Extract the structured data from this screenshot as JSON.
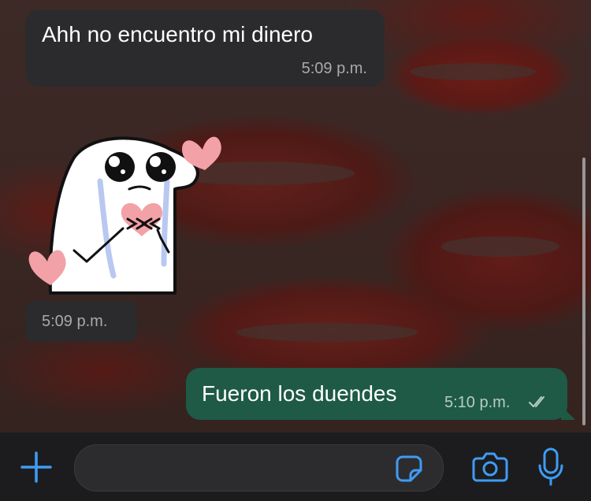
{
  "messages": [
    {
      "direction": "incoming",
      "text": "Ahh no encuentro mi dinero",
      "time": "5:09 p.m."
    },
    {
      "direction": "incoming",
      "type": "sticker",
      "time": "5:09 p.m."
    },
    {
      "direction": "outgoing",
      "text": "Fueron los duendes",
      "time": "5:10 p.m.",
      "status": "read"
    }
  ],
  "input": {
    "placeholder": "",
    "value": ""
  },
  "icons": {
    "attach": "plus-icon",
    "sticker": "sticker-icon",
    "camera": "camera-icon",
    "mic": "microphone-icon",
    "read_status": "double-check-icon"
  },
  "colors": {
    "accent": "#3e9cf5",
    "incoming_bubble": "#2b2b2e",
    "outgoing_bubble": "#1e5a46",
    "time_text": "#a7a9ac"
  }
}
